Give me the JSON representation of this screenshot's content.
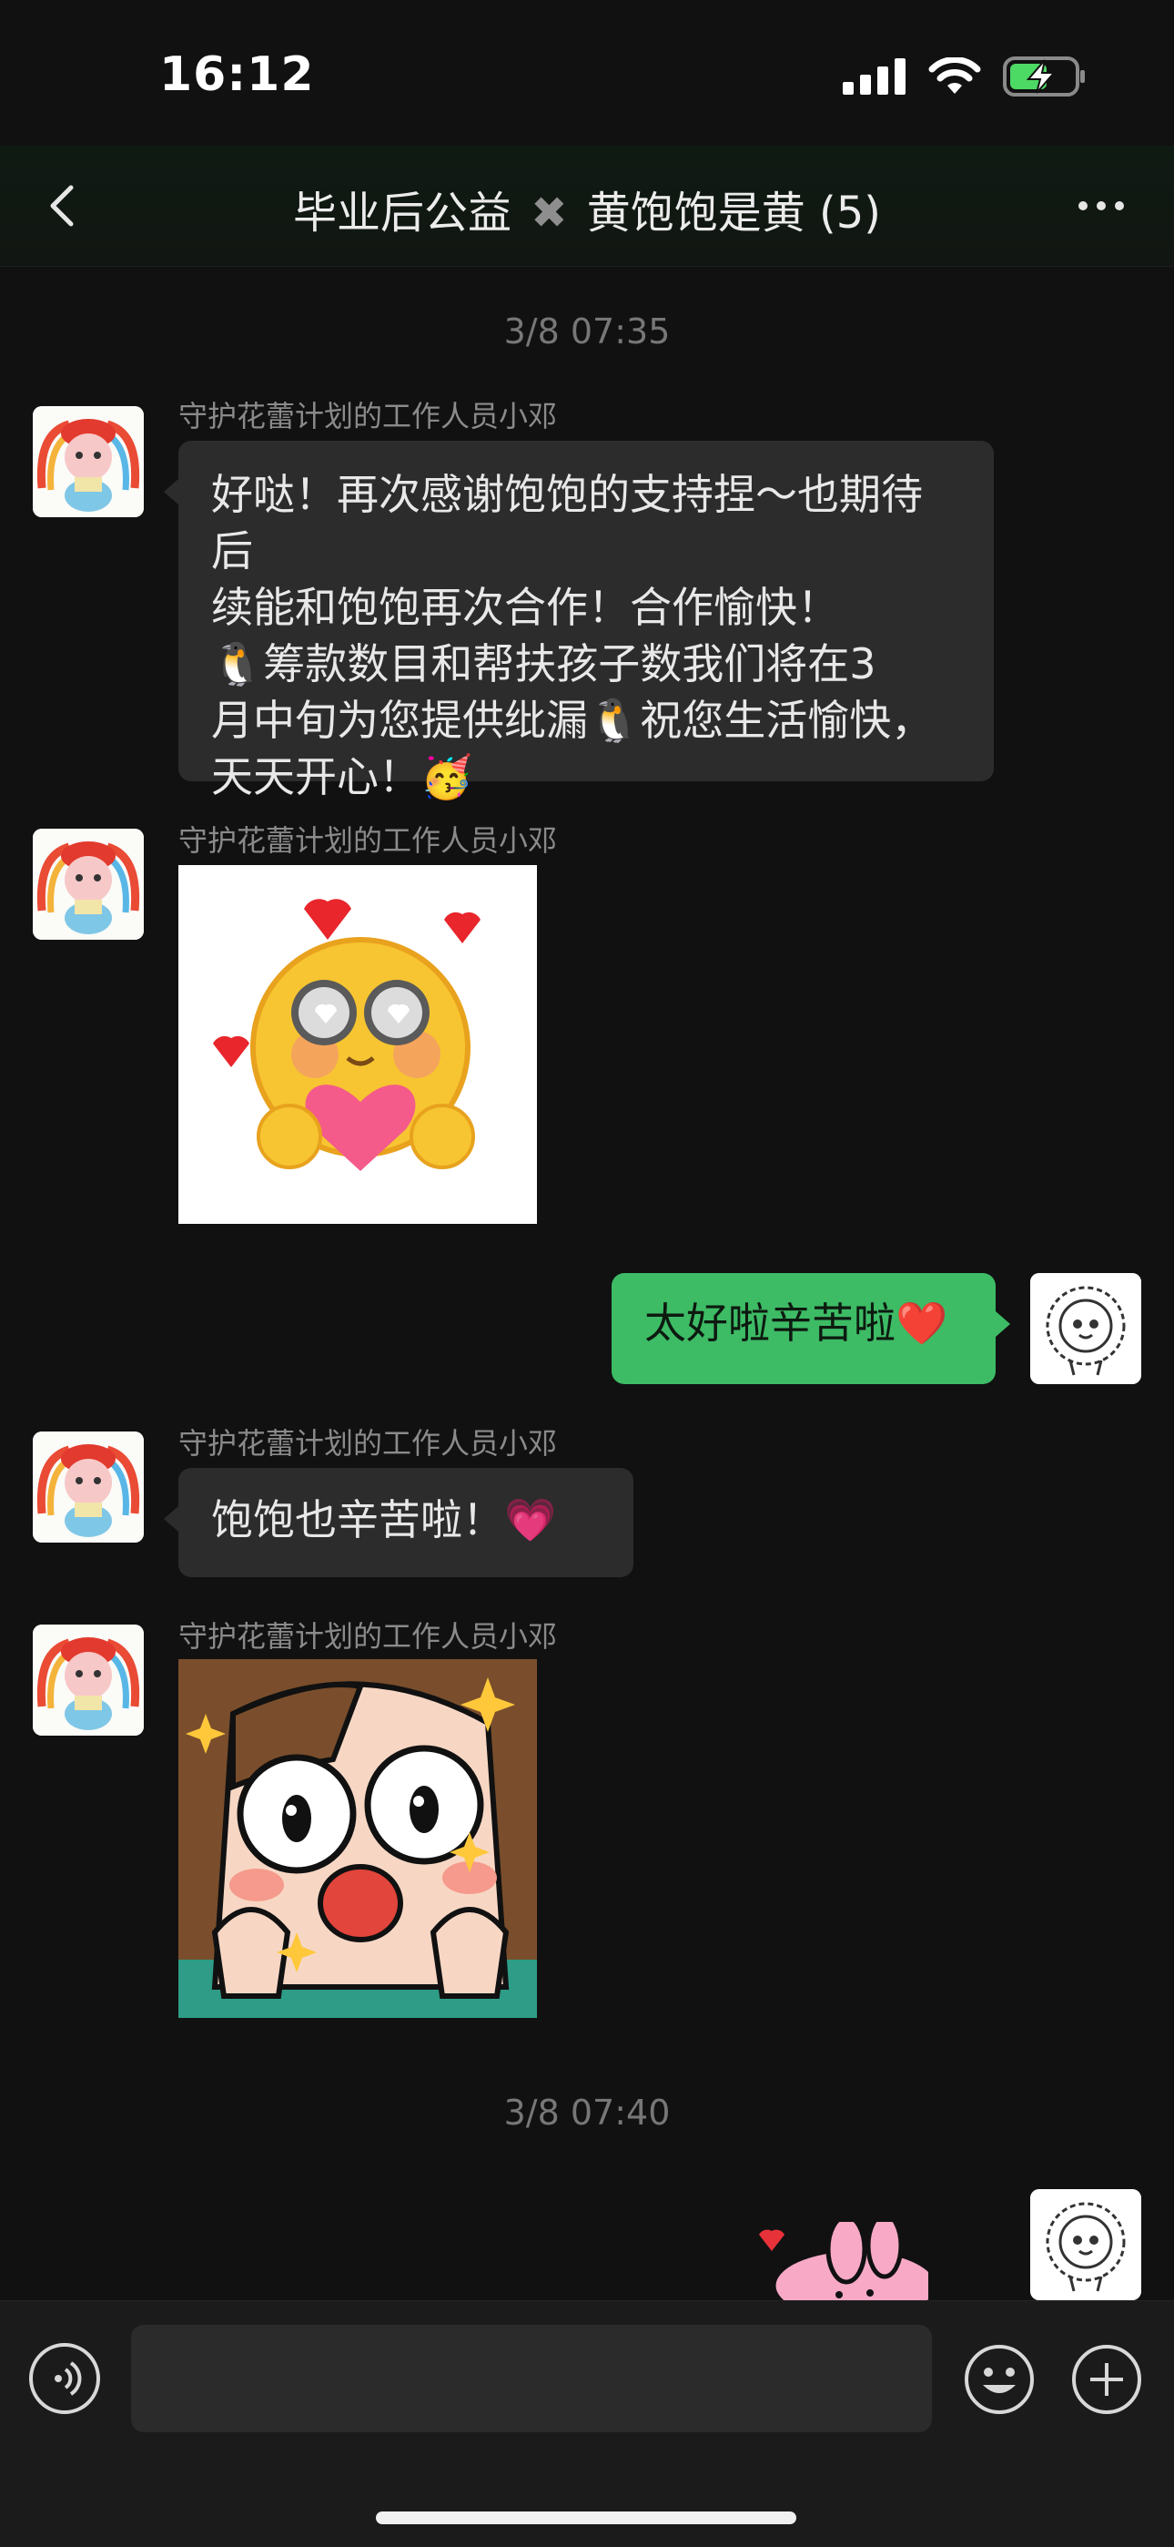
{
  "status_bar": {
    "time": "16:12"
  },
  "header": {
    "title_part1": "毕业后公益",
    "title_separator": "✖",
    "title_part2": "黄饱饱是黄",
    "member_count": "(5)"
  },
  "messages": {
    "timestamp_1": "3/8 07:35",
    "timestamp_2": "3/8 07:40",
    "sender_name": "守护花蕾计划的工作人员小邓",
    "msg1_line1": "好哒！再次感谢饱饱的支持捏～也期待后",
    "msg1_line2": "续能和饱饱再次合作！合作愉快！",
    "msg1_line3": "筹款数目和帮扶孩子数我们将在3",
    "msg1_line4": "月中旬为您提供纰漏",
    "msg1_line4b": "祝您生活愉快，",
    "msg1_line5": "天天开心！",
    "msg_out_1": "太好啦辛苦啦",
    "msg3": "饱饱也辛苦啦！",
    "heart_emoji": "❤️",
    "pink_heart_emoji": "💗",
    "party_emoji": "🥳",
    "penguin_emoji": "🐧"
  },
  "input": {
    "placeholder": ""
  },
  "colors": {
    "bubble_out": "#3dbb65",
    "bubble_in": "#2c2c2c",
    "background": "#111111"
  }
}
